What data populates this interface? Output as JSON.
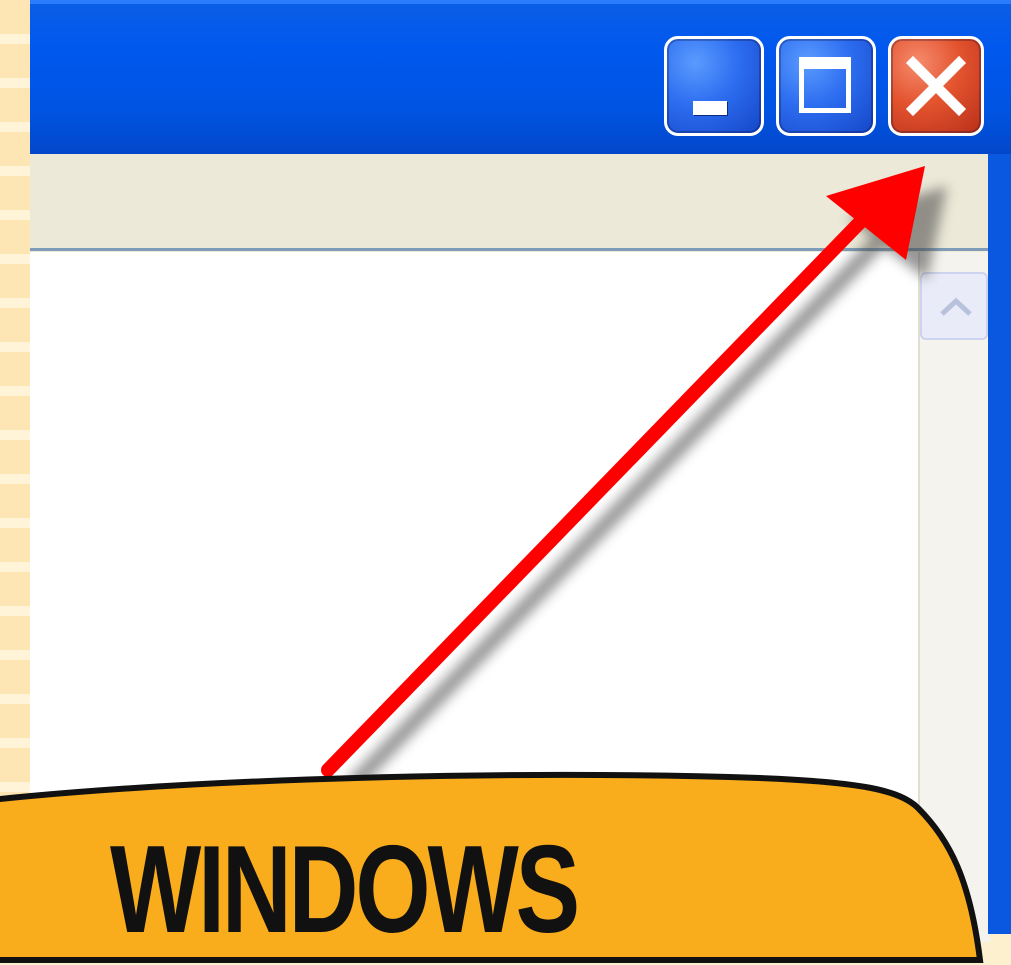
{
  "window": {
    "buttons": {
      "minimize": {
        "icon": "minimize-icon"
      },
      "maximize": {
        "icon": "maximize-icon"
      },
      "close": {
        "icon": "close-icon"
      }
    },
    "scrollbar": {
      "up_icon": "chevron-up-icon"
    }
  },
  "callout": {
    "text": "WINDOWS",
    "color": "#f9ac1c"
  },
  "arrow": {
    "color": "#ff0000"
  }
}
